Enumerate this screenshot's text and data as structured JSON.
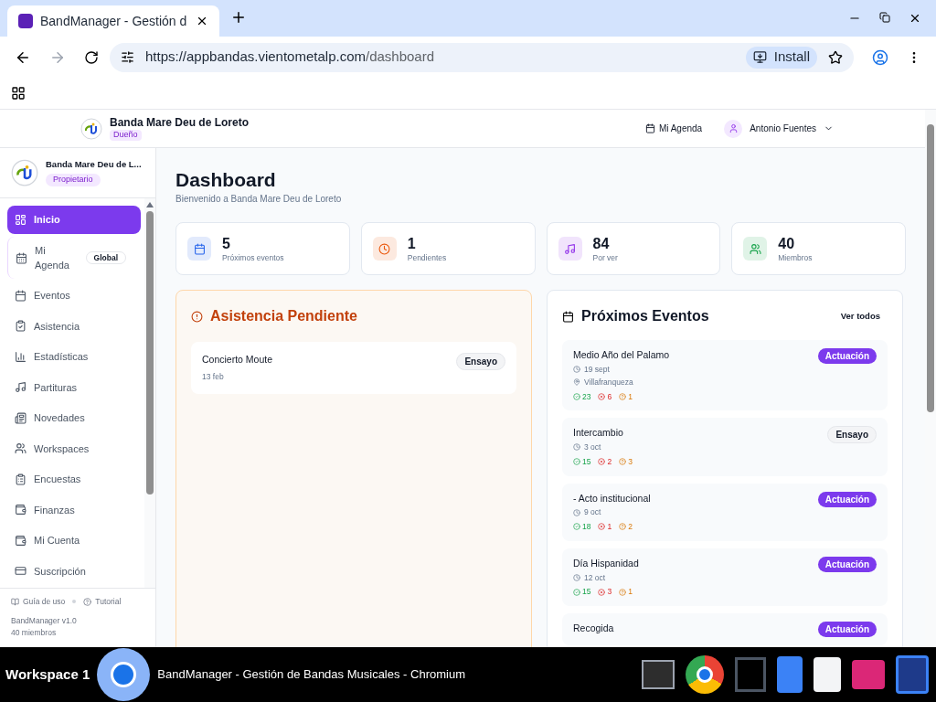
{
  "browser": {
    "tab_title": "BandManager - Gestión d",
    "url_host": "https://appbandas.vientometalp.com",
    "url_path": "/dashboard",
    "install": "Install"
  },
  "header": {
    "band": "Banda Mare Deu de Loreto",
    "role": "Dueño",
    "agenda": "Mi Agenda",
    "user": "Antonio Fuentes"
  },
  "sidebar": {
    "band": "Banda Mare Deu de L...",
    "role": "Propietario",
    "items": [
      {
        "label": "Inicio",
        "selected": true
      },
      {
        "label": "Mi Agenda",
        "selected": false,
        "badge": "Global"
      },
      {
        "label": "Eventos",
        "selected": false
      },
      {
        "label": "Asistencia",
        "selected": false
      },
      {
        "label": "Estadísticas",
        "selected": false
      },
      {
        "label": "Partituras",
        "selected": false
      },
      {
        "label": "Novedades",
        "selected": false
      },
      {
        "label": "Workspaces",
        "selected": false
      },
      {
        "label": "Encuestas",
        "selected": false
      },
      {
        "label": "Finanzas",
        "selected": false
      },
      {
        "label": "Mi Cuenta",
        "selected": false
      },
      {
        "label": "Suscripción",
        "selected": false
      }
    ],
    "guide": "Guía de uso",
    "tutorial": "Tutorial",
    "version": "BandManager v1.0",
    "members": "40 miembros"
  },
  "page": {
    "title": "Dashboard",
    "subtitle": "Bienvenido a Banda Mare Deu de Loreto"
  },
  "stats": [
    {
      "value": "5",
      "label": "Próximos eventos",
      "color": "#2563eb"
    },
    {
      "value": "1",
      "label": "Pendientes",
      "color": "#ea580c"
    },
    {
      "value": "84",
      "label": "Por ver",
      "color": "#9333ea"
    },
    {
      "value": "40",
      "label": "Miembros",
      "color": "#16a34a"
    }
  ],
  "pending": {
    "title": "Asistencia Pendiente",
    "items": [
      {
        "name": "Concierto Moute",
        "date": "13 feb",
        "type": "Ensayo",
        "kind": "rehearsal"
      }
    ]
  },
  "events": {
    "title": "Próximos Eventos",
    "see_all": "Ver todos",
    "items": [
      {
        "name": "Medio Año del Palamo",
        "date": "19 sept",
        "location": "Villafranqueza",
        "type": "Actuación",
        "kind": "performance",
        "yes": "23",
        "no": "6",
        "maybe": "1"
      },
      {
        "name": "Intercambio",
        "date": "3 oct",
        "type": "Ensayo",
        "kind": "rehearsal",
        "yes": "15",
        "no": "2",
        "maybe": "3"
      },
      {
        "name": "- Acto institucional",
        "date": "9 oct",
        "type": "Actuación",
        "kind": "performance",
        "yes": "18",
        "no": "1",
        "maybe": "2"
      },
      {
        "name": "Día Hispanidad",
        "date": "12 oct",
        "type": "Actuación",
        "kind": "performance",
        "yes": "15",
        "no": "3",
        "maybe": "1"
      },
      {
        "name": "Recogida",
        "type": "Actuación",
        "kind": "performance"
      }
    ]
  },
  "taskbar": {
    "workspace": "Workspace 1",
    "window": "BandManager - Gestión de Bandas Musicales - Chromium"
  }
}
